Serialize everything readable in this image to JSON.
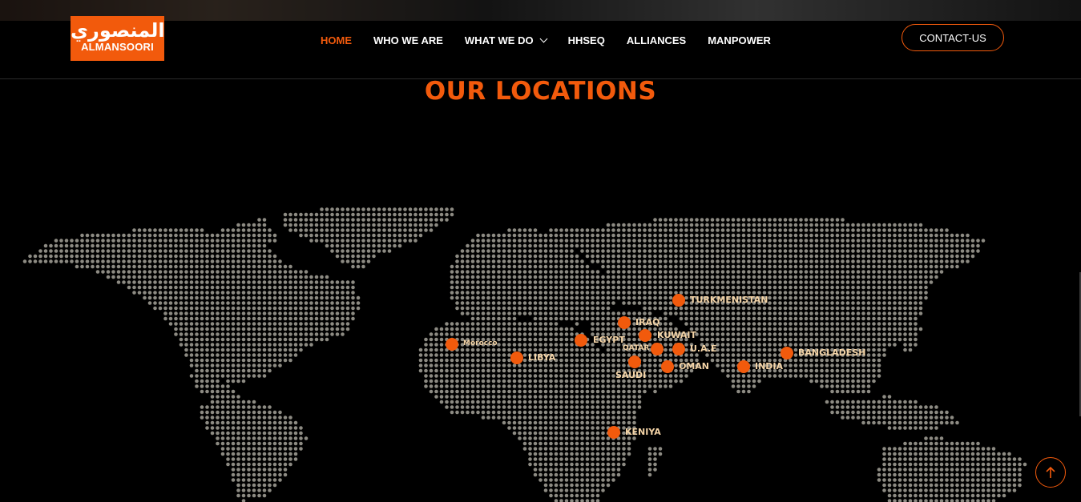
{
  "header": {
    "logo": {
      "arabic": "المنصوري",
      "latin": "ALMANSOORI"
    },
    "nav": [
      {
        "label": "HOME",
        "active": true
      },
      {
        "label": "WHO WE ARE"
      },
      {
        "label": "WHAT WE DO",
        "has_dropdown": true
      },
      {
        "label": "HHSEQ"
      },
      {
        "label": "ALLIANCES"
      },
      {
        "label": "MANPOWER"
      }
    ],
    "contact_label": "CONTACT-US"
  },
  "section": {
    "title": "OUR LOCATIONS"
  },
  "locations": [
    {
      "name": "Morocco"
    },
    {
      "name": "LIBYA"
    },
    {
      "name": "EGYPT"
    },
    {
      "name": "IRAQ"
    },
    {
      "name": "KUWAIT"
    },
    {
      "name": "QATAR"
    },
    {
      "name": "U.A.E"
    },
    {
      "name": "SAUDI"
    },
    {
      "name": "OMAN"
    },
    {
      "name": "TURKMENISTAN"
    },
    {
      "name": "INDIA"
    },
    {
      "name": "BANGLADESH"
    },
    {
      "name": "KENIYA"
    }
  ],
  "colors": {
    "accent": "#f25a0c",
    "label": "#f3d3a6",
    "land_dot": "#8d8b83",
    "background": "#000000"
  },
  "icons": {
    "scroll_top": "arrow-up-icon",
    "dropdown": "chevron-down-icon"
  }
}
